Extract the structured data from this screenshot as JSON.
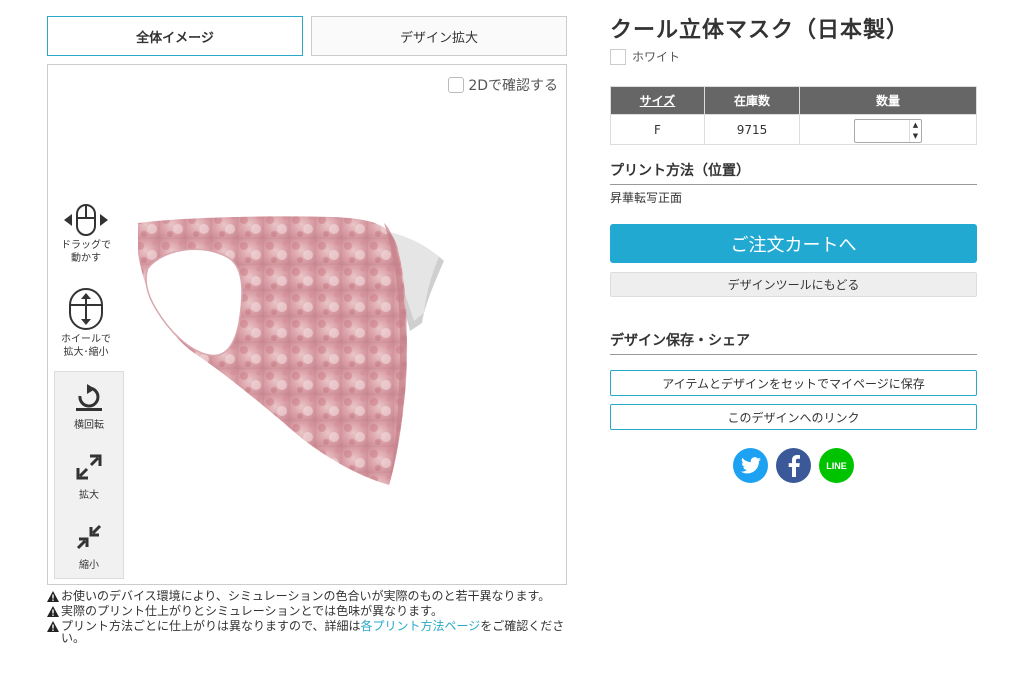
{
  "tabs": {
    "full": "全体イメージ",
    "zoom": "デザイン拡大"
  },
  "viewer": {
    "check_2d": "2Dで確認する",
    "drag_label": "ドラッグで\n動かす",
    "wheel_label": "ホイールで\n拡大･縮小",
    "tools": {
      "rotate": "横回転",
      "zoom_in": "拡大",
      "zoom_out": "縮小"
    }
  },
  "notes": {
    "n1": "お使いのデバイス環境により、シミュレーションの色合いが実際のものと若干異なります。",
    "n2": "実際のプリント仕上がりとシミュレーションとでは色味が異なります。",
    "n3_prefix": "プリント方法ごとに仕上がりは異なりますので、詳細は",
    "n3_link": "各プリント方法ページ",
    "n3_suffix": "をご確認ください。"
  },
  "product": {
    "title": "クール立体マスク（日本製）",
    "color": "ホワイト"
  },
  "stock_table": {
    "headers": [
      "サイズ",
      "在庫数",
      "数量"
    ],
    "rows": [
      {
        "size": "F",
        "stock": "9715",
        "qty": ""
      }
    ]
  },
  "print": {
    "section_title": "プリント方法（位置）",
    "method": "昇華転写正面"
  },
  "buttons": {
    "cart": "ご注文カートへ",
    "back": "デザインツールにもどる"
  },
  "share": {
    "section_title": "デザイン保存・シェア",
    "save": "アイテムとデザインをセットでマイページに保存",
    "link": "このデザインへのリンク",
    "line": "LINE"
  },
  "colors": {
    "accent": "#22a9d2",
    "twitter": "#1da1f2",
    "facebook": "#3b5998",
    "line": "#00c300",
    "table_header": "#666666"
  }
}
